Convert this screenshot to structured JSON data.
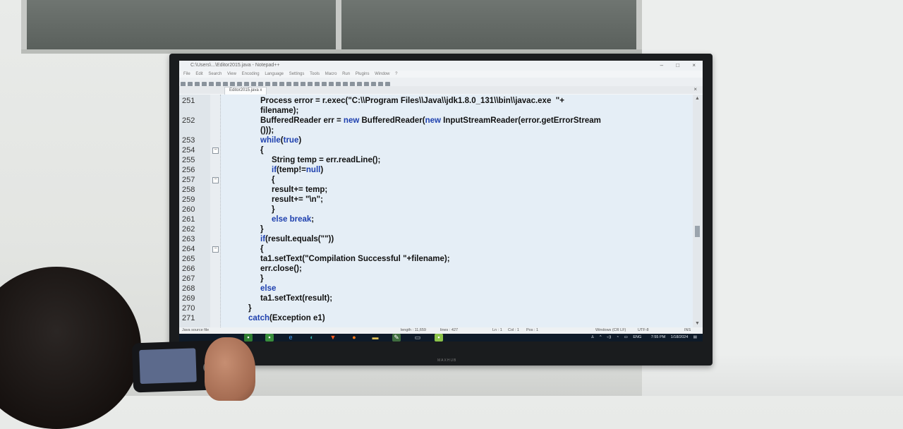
{
  "window": {
    "title": "C:\\Users\\...\\Editor2015.java - Notepad++",
    "controls": [
      "–",
      "□",
      "×"
    ]
  },
  "menu": [
    "File",
    "Edit",
    "Search",
    "View",
    "Encoding",
    "Language",
    "Settings",
    "Tools",
    "Macro",
    "Run",
    "Plugins",
    "Window",
    "?"
  ],
  "tab": {
    "label": "Editor2015.java",
    "close": "x"
  },
  "lines": [
    {
      "num": "251",
      "indent": 1,
      "parts": [
        {
          "t": "Process error = r.exec(",
          "c": ""
        },
        {
          "t": "\"C:\\\\Program Files\\\\Java\\\\jdk1.8.0_131\\\\bin\\\\javac.exe  \"+",
          "c": "plain"
        }
      ]
    },
    {
      "num": "",
      "indent": 1,
      "parts": [
        {
          "t": "filename);",
          "c": ""
        }
      ]
    },
    {
      "num": "252",
      "indent": 1,
      "parts": [
        {
          "t": "BufferedReader err = ",
          "c": ""
        },
        {
          "t": "new",
          "c": "kw"
        },
        {
          "t": " BufferedReader(",
          "c": ""
        },
        {
          "t": "new",
          "c": "kw"
        },
        {
          "t": " InputStreamReader(error.getErrorStream",
          "c": ""
        }
      ]
    },
    {
      "num": "",
      "indent": 1,
      "parts": [
        {
          "t": "()));",
          "c": ""
        }
      ]
    },
    {
      "num": "253",
      "indent": 1,
      "parts": [
        {
          "t": "while",
          "c": "kw"
        },
        {
          "t": "(",
          "c": ""
        },
        {
          "t": "true",
          "c": "kw"
        },
        {
          "t": ")",
          "c": ""
        }
      ]
    },
    {
      "num": "254",
      "indent": 1,
      "fold": true,
      "parts": [
        {
          "t": "{",
          "c": ""
        }
      ]
    },
    {
      "num": "255",
      "indent": 2,
      "parts": [
        {
          "t": "String temp = err.readLine();",
          "c": ""
        }
      ]
    },
    {
      "num": "256",
      "indent": 2,
      "parts": [
        {
          "t": "if",
          "c": "kw"
        },
        {
          "t": "(temp!=",
          "c": ""
        },
        {
          "t": "null",
          "c": "kw"
        },
        {
          "t": ")",
          "c": ""
        }
      ]
    },
    {
      "num": "257",
      "indent": 2,
      "fold": true,
      "parts": [
        {
          "t": "{",
          "c": ""
        }
      ]
    },
    {
      "num": "258",
      "indent": 2,
      "parts": [
        {
          "t": "result+= temp;",
          "c": ""
        }
      ]
    },
    {
      "num": "259",
      "indent": 2,
      "parts": [
        {
          "t": "result+= ",
          "c": ""
        },
        {
          "t": "\"\\n\"",
          "c": "plain"
        },
        {
          "t": ";",
          "c": ""
        }
      ]
    },
    {
      "num": "260",
      "indent": 2,
      "parts": [
        {
          "t": "}",
          "c": ""
        }
      ]
    },
    {
      "num": "261",
      "indent": 2,
      "parts": [
        {
          "t": "else",
          "c": "kw"
        },
        {
          "t": " ",
          "c": ""
        },
        {
          "t": "break",
          "c": "kw"
        },
        {
          "t": ";",
          "c": ""
        }
      ]
    },
    {
      "num": "262",
      "indent": 1,
      "parts": [
        {
          "t": "}",
          "c": ""
        }
      ]
    },
    {
      "num": "263",
      "indent": 1,
      "parts": [
        {
          "t": "if",
          "c": "kw"
        },
        {
          "t": "(result.equals(",
          "c": ""
        },
        {
          "t": "\"\"",
          "c": "plain"
        },
        {
          "t": "))",
          "c": ""
        }
      ]
    },
    {
      "num": "264",
      "indent": 1,
      "fold": true,
      "parts": [
        {
          "t": "{",
          "c": ""
        }
      ]
    },
    {
      "num": "265",
      "indent": 1,
      "parts": [
        {
          "t": "ta1.setText(",
          "c": ""
        },
        {
          "t": "\"Compilation Successful \"",
          "c": "plain"
        },
        {
          "t": "+filename);",
          "c": ""
        }
      ]
    },
    {
      "num": "266",
      "indent": 1,
      "parts": [
        {
          "t": "err.close();",
          "c": ""
        }
      ]
    },
    {
      "num": "267",
      "indent": 1,
      "parts": [
        {
          "t": "}",
          "c": ""
        }
      ]
    },
    {
      "num": "268",
      "indent": 1,
      "parts": [
        {
          "t": "else",
          "c": "kw"
        }
      ]
    },
    {
      "num": "269",
      "indent": 1,
      "parts": [
        {
          "t": "ta1.setText(result);",
          "c": ""
        }
      ]
    },
    {
      "num": "270",
      "indent": 0,
      "parts": [
        {
          "t": "}",
          "c": ""
        }
      ]
    },
    {
      "num": "271",
      "indent": 0,
      "parts": [
        {
          "t": "catch",
          "c": "kw"
        },
        {
          "t": "(Exception e1)",
          "c": ""
        }
      ]
    }
  ],
  "status": {
    "file_type": "Java source file",
    "length": "length : 11,659",
    "lines": "lines : 427",
    "ln": "Ln : 1",
    "col": "Col : 1",
    "pos": "Pos : 1",
    "eol": "Windows (CR LF)",
    "encoding": "UTF-8",
    "mode": "INS"
  },
  "tray": {
    "lang": "ENG",
    "time": "7:55 PM",
    "date": "1/18/2024"
  },
  "tv_brand": "MAXHUB",
  "colors": {
    "keyword": "#1d3fae",
    "editor_bg": "#e5eef6",
    "taskbar": "#0e1a28"
  }
}
